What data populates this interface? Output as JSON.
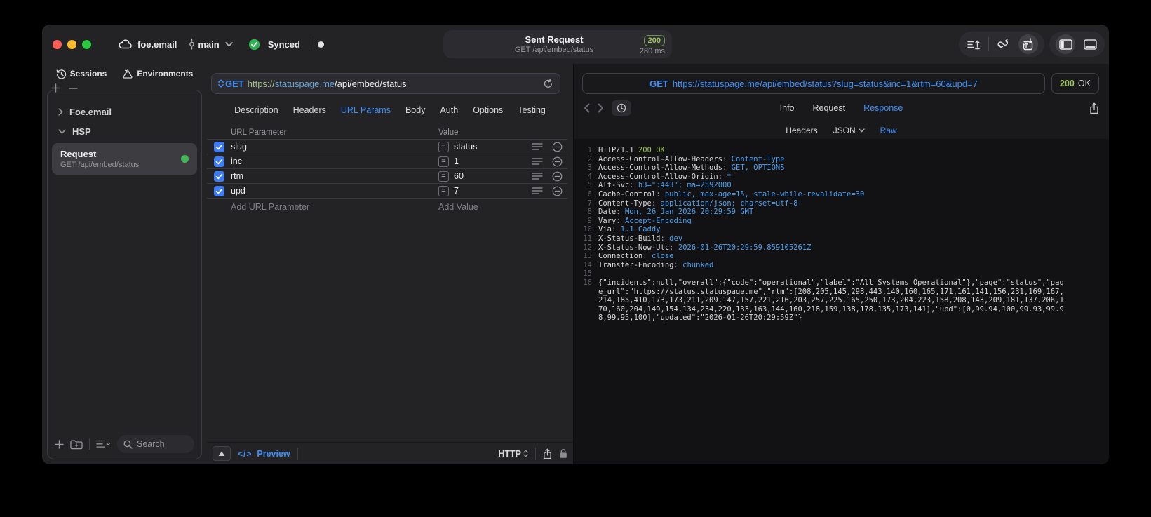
{
  "colors": {
    "accent_blue": "#3f8ef6",
    "status_green": "#9fc45a",
    "url_scheme_green": "#a6bd8d",
    "url_host_blue": "#6ba3d6",
    "checkbox_blue": "#3d7cf5",
    "synced_green": "#2eb350",
    "record_green": "#46b75a"
  },
  "icons": {
    "cloud-icon": "cloud outline",
    "branch-icon": "commit marker",
    "chevron-down-icon": "v",
    "synced-check-icon": "green circle check",
    "status-dot": "white dot",
    "lines-arrow-up-icon": "list with up arrow",
    "loop-arrows-icon": "looped arrows",
    "transfer-arrows-icon": "box with in/out arrows",
    "left-panel-icon": "window with left sidebar",
    "bottom-panel-icon": "window with bottom panel",
    "sessions-icon": "history clock",
    "environments-icon": "cycle triangle",
    "equals-icon": "=",
    "search-icon": "magnifier",
    "lock-icon": "padlock"
  },
  "titlebar": {
    "project": "foe.email",
    "branch": "main",
    "sync_label": "Synced",
    "request_summary": {
      "title": "Sent Request",
      "subtitle": "GET /api/embed/status",
      "status_code": "200",
      "duration": "280 ms"
    }
  },
  "sidebar": {
    "tabs": [
      {
        "label": "Sessions"
      },
      {
        "label": "Environments"
      }
    ],
    "tree": {
      "groups": [
        {
          "label": "Foe.email"
        },
        {
          "label": "HSP"
        }
      ],
      "request": {
        "title": "Request",
        "subtitle": "GET /api/embed/status"
      }
    },
    "search": {
      "placeholder": "Search"
    }
  },
  "request_editor": {
    "method": "GET",
    "url": {
      "scheme": "https://",
      "host": "statuspage.me",
      "path": "/api/embed/status"
    },
    "tabs": [
      "Description",
      "Headers",
      "URL Params",
      "Body",
      "Auth",
      "Options",
      "Testing"
    ],
    "active_tab": "URL Params",
    "params": {
      "name_header": "URL Parameter",
      "value_header": "Value",
      "rows": [
        {
          "name": "slug",
          "value": "status",
          "enabled": true
        },
        {
          "name": "inc",
          "value": "1",
          "enabled": true
        },
        {
          "name": "rtm",
          "value": "60",
          "enabled": true
        },
        {
          "name": "upd",
          "value": "7",
          "enabled": true
        }
      ],
      "add_name_placeholder": "Add URL Parameter",
      "add_value_placeholder": "Add Value"
    },
    "footer": {
      "code_glyph": "</>",
      "preview_label": "Preview",
      "protocol_label": "HTTP"
    }
  },
  "response_viewer": {
    "request_line": {
      "method": "GET",
      "url": "https://statuspage.me/api/embed/status?slug=status&inc=1&rtm=60&upd=7"
    },
    "status": {
      "code": "200",
      "text": "OK"
    },
    "tabs": [
      "Info",
      "Request",
      "Response"
    ],
    "active_tab": "Response",
    "subtabs": [
      "Headers",
      "JSON",
      "Raw"
    ],
    "active_subtab": "Raw",
    "body_lines": [
      {
        "num": "1",
        "segments": [
          {
            "text": "HTTP/1.1 ",
            "color": "plain"
          },
          {
            "text": "200 OK",
            "color": "green"
          }
        ]
      },
      {
        "num": "2",
        "segments": [
          {
            "text": "Access-Control-Allow-Headers",
            "color": "plain"
          },
          {
            "text": ": ",
            "color": "dim"
          },
          {
            "text": "Content-Type",
            "color": "blue"
          }
        ]
      },
      {
        "num": "3",
        "segments": [
          {
            "text": "Access-Control-Allow-Methods",
            "color": "plain"
          },
          {
            "text": ": ",
            "color": "dim"
          },
          {
            "text": "GET, OPTIONS",
            "color": "blue"
          }
        ]
      },
      {
        "num": "4",
        "segments": [
          {
            "text": "Access-Control-Allow-Origin",
            "color": "plain"
          },
          {
            "text": ": ",
            "color": "dim"
          },
          {
            "text": "*",
            "color": "blue"
          }
        ]
      },
      {
        "num": "5",
        "segments": [
          {
            "text": "Alt-Svc",
            "color": "plain"
          },
          {
            "text": ": ",
            "color": "dim"
          },
          {
            "text": "h3=\":443\"; ma=2592000",
            "color": "blue"
          }
        ]
      },
      {
        "num": "6",
        "segments": [
          {
            "text": "Cache-Control",
            "color": "plain"
          },
          {
            "text": ": ",
            "color": "dim"
          },
          {
            "text": "public, max-age=15, stale-while-revalidate=30",
            "color": "blue"
          }
        ]
      },
      {
        "num": "7",
        "segments": [
          {
            "text": "Content-Type",
            "color": "plain"
          },
          {
            "text": ": ",
            "color": "dim"
          },
          {
            "text": "application/json; charset=utf-8",
            "color": "blue"
          }
        ]
      },
      {
        "num": "8",
        "segments": [
          {
            "text": "Date",
            "color": "plain"
          },
          {
            "text": ": ",
            "color": "dim"
          },
          {
            "text": "Mon, 26 Jan 2026 20:29:59 GMT",
            "color": "blue"
          }
        ]
      },
      {
        "num": "9",
        "segments": [
          {
            "text": "Vary",
            "color": "plain"
          },
          {
            "text": ": ",
            "color": "dim"
          },
          {
            "text": "Accept-Encoding",
            "color": "blue"
          }
        ]
      },
      {
        "num": "10",
        "segments": [
          {
            "text": "Via",
            "color": "plain"
          },
          {
            "text": ": ",
            "color": "dim"
          },
          {
            "text": "1.1 Caddy",
            "color": "blue"
          }
        ]
      },
      {
        "num": "11",
        "segments": [
          {
            "text": "X-Status-Build",
            "color": "plain"
          },
          {
            "text": ": ",
            "color": "dim"
          },
          {
            "text": "dev",
            "color": "blue"
          }
        ]
      },
      {
        "num": "12",
        "segments": [
          {
            "text": "X-Status-Now-Utc",
            "color": "plain"
          },
          {
            "text": ": ",
            "color": "dim"
          },
          {
            "text": "2026-01-26T20:29:59.859105261Z",
            "color": "blue"
          }
        ]
      },
      {
        "num": "13",
        "segments": [
          {
            "text": "Connection",
            "color": "plain"
          },
          {
            "text": ": ",
            "color": "dim"
          },
          {
            "text": "close",
            "color": "blue"
          }
        ]
      },
      {
        "num": "14",
        "segments": [
          {
            "text": "Transfer-Encoding",
            "color": "plain"
          },
          {
            "text": ": ",
            "color": "dim"
          },
          {
            "text": "chunked",
            "color": "blue"
          }
        ]
      },
      {
        "num": "15",
        "segments": []
      },
      {
        "num": "16",
        "segments": [
          {
            "text": "{\"incidents\":null,\"overall\":{\"code\":\"operational\",\"label\":\"All Systems Operational\"},\"page\":\"status\",\"page_url\":\"https://status.statuspage.me\",\"rtm\":[208,205,145,298,443,140,160,165,171,161,141,156,231,169,167,214,185,410,173,173,211,209,147,157,221,216,203,257,225,165,250,173,204,223,158,208,143,209,181,137,206,170,160,204,149,154,134,234,220,133,163,144,160,218,159,138,178,135,173,141],\"upd\":[0,99.94,100,99.93,99.98,99.95,100],\"updated\":\"2026-01-26T20:29:59Z\"}",
            "color": "plain"
          }
        ]
      }
    ]
  }
}
